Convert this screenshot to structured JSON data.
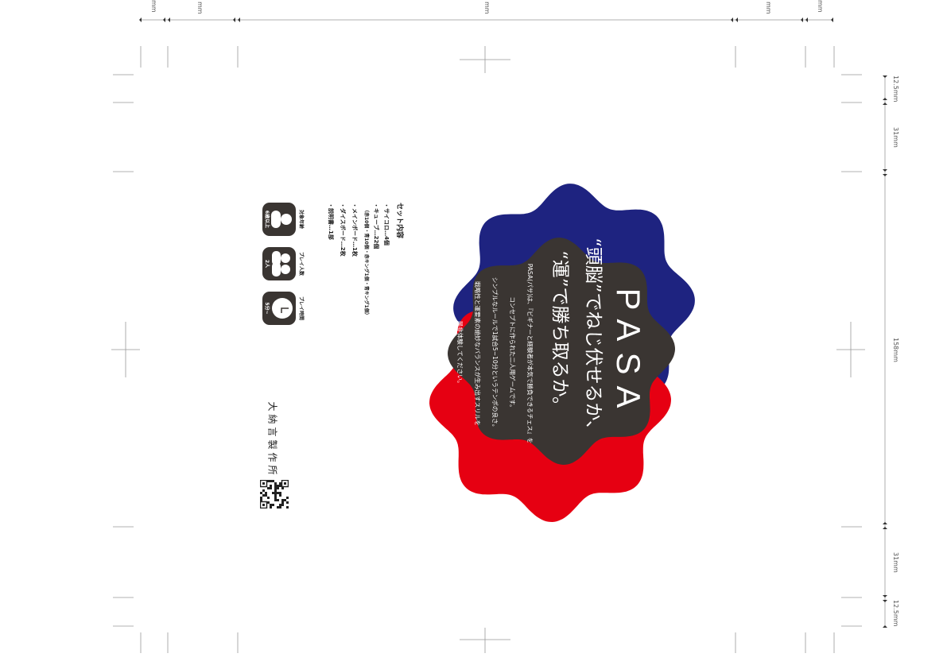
{
  "rulers": {
    "top": [
      "mm",
      "mm",
      "mm",
      "mm",
      "mm"
    ],
    "right": [
      "12.5mm",
      "31mm",
      "158mm",
      "31mm",
      "12.5mm"
    ]
  },
  "hero": {
    "title": "PASA",
    "headline1": "“頭脳”でねじ伏せるか、",
    "headline2": "“運”で勝ち取るか。",
    "body": [
      "PASA(パサ)は、『ビギナーと経験者が本気で勝負できるチェス』を",
      "コンセプトに作られた二人用ゲームです。",
      "シンプルなルールで1試合5~10分というテンポの良さ。",
      "戦略性と運要素の絶妙なバランスが生み出すスリルを",
      "是非体験してください。"
    ],
    "colors": {
      "blue": "#1e2380",
      "red": "#e60012",
      "dark": "#3a3532"
    }
  },
  "set": {
    "heading": "セット内容",
    "items": [
      "・サイコロ…4個",
      "・キューブ…22個",
      "（赤10個・青10個・赤キング1個・青キング1個）",
      "・メインボード…1枚",
      "・ダイスボード…2枚",
      "・説明書…1部"
    ]
  },
  "icons": [
    {
      "label": "対象年齢",
      "value": "6歳以上",
      "icon": "person-icon"
    },
    {
      "label": "プレイ人数",
      "value": "2人",
      "icon": "two-people-icon"
    },
    {
      "label": "プレイ時間",
      "value": "5分~",
      "icon": "clock-icon"
    }
  ],
  "brand": "大納言製作所"
}
